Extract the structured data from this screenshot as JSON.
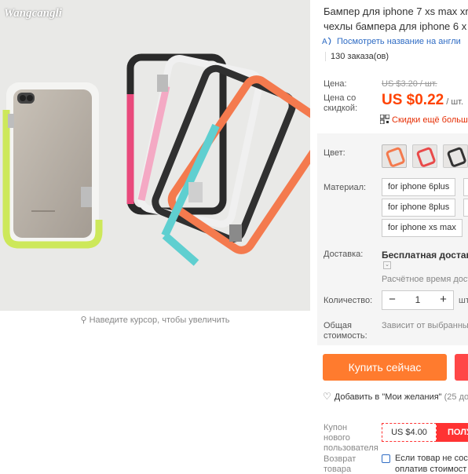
{
  "gallery": {
    "watermark": "Wangcangli",
    "zoom_hint": "Наведите курсор, чтобы увеличить"
  },
  "product": {
    "title_line1": "Бампер для iphone 7 xs max xr",
    "title_line2": "чехлы бампера для iphone 6 x",
    "translate_link": "Посмотреть название на англи",
    "orders": "130 заказа(ов)"
  },
  "price": {
    "label": "Цена:",
    "old": "US $3.20 / шт.",
    "discount_label": "Цена со скидкой:",
    "current": "US $0.22",
    "unit": "/ шт.",
    "more_discounts": "Скидки ещё больш",
    "accent_color": "#ff4200"
  },
  "options": {
    "color_label": "Цвет:",
    "material_label": "Материал:",
    "materials": [
      "for iphone 6plus",
      "for iphone 8plus",
      "for iphone xs max"
    ]
  },
  "shipping": {
    "label": "Доставка:",
    "free": "Бесплатная доставка",
    "time": "Расчётное время дост"
  },
  "quantity": {
    "label": "Количество:",
    "minus": "−",
    "value": "1",
    "plus": "+",
    "unit": "шт."
  },
  "total": {
    "label": "Общая стоимость:",
    "value": "Зависит от выбранны"
  },
  "actions": {
    "buy_now": "Купить сейчас",
    "buy_color": "#ff7b2e",
    "wishlist": "Добавить в \"Мои желания\"",
    "wishlist_count": "(25 до"
  },
  "coupon": {
    "label": "Купон нового пользователя",
    "amount": "US $4.00",
    "get": "ПОЛУ"
  },
  "returns": {
    "label": "Возврат товара",
    "text_line1": "Если товар не сост",
    "text_line2": "оплатив стоимост"
  }
}
